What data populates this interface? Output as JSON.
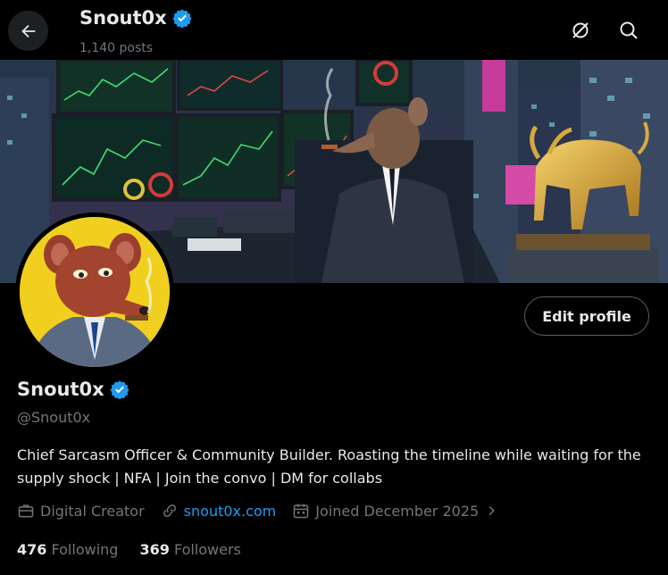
{
  "header": {
    "name": "Snout0x",
    "posts": "1,140 posts"
  },
  "profile": {
    "name": "Snout0x",
    "handle": "@Snout0x",
    "bio": "Chief Sarcasm Officer & Community Builder. Roasting the timeline while waiting for the supply shock | NFA | Join the convo | DM for collabs",
    "category": "Digital Creator",
    "website": "snout0x.com",
    "joined": "Joined December 2025",
    "following_count": "476",
    "following_label": "Following",
    "followers_count": "369",
    "followers_label": "Followers",
    "edit_label": "Edit profile"
  },
  "colors": {
    "verified": "#1d9bf0",
    "link": "#1d9bf0",
    "muted": "#71767b"
  },
  "icons": [
    "back-arrow-icon",
    "verified-badge-icon",
    "dismiss-circle-icon",
    "search-icon",
    "briefcase-icon",
    "link-icon",
    "calendar-icon",
    "chevron-right-icon"
  ]
}
